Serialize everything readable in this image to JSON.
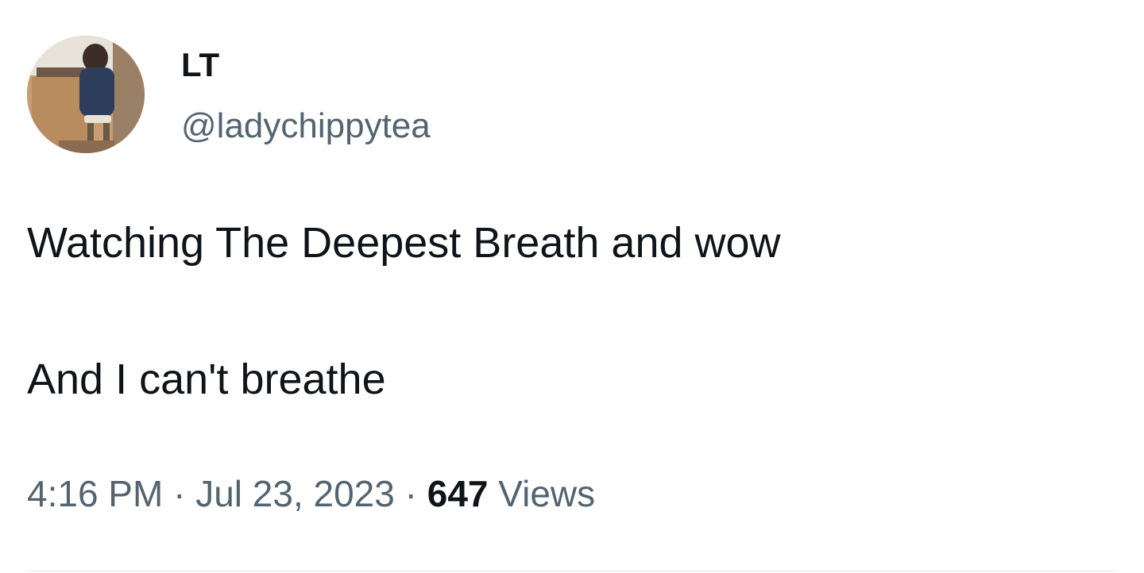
{
  "author": {
    "display_name": "LT",
    "handle": "@ladychippytea",
    "avatar": "profile-photo"
  },
  "tweet": {
    "lines": [
      "Watching The Deepest Breath and wow",
      "And I can't breathe"
    ]
  },
  "meta": {
    "time": "4:16 PM",
    "separator": " · ",
    "date": "Jul 23, 2023",
    "views_count": "647",
    "views_label": " Views"
  },
  "colors": {
    "text_primary": "#0f1419",
    "text_secondary": "#536471",
    "divider": "#eff3f4"
  }
}
